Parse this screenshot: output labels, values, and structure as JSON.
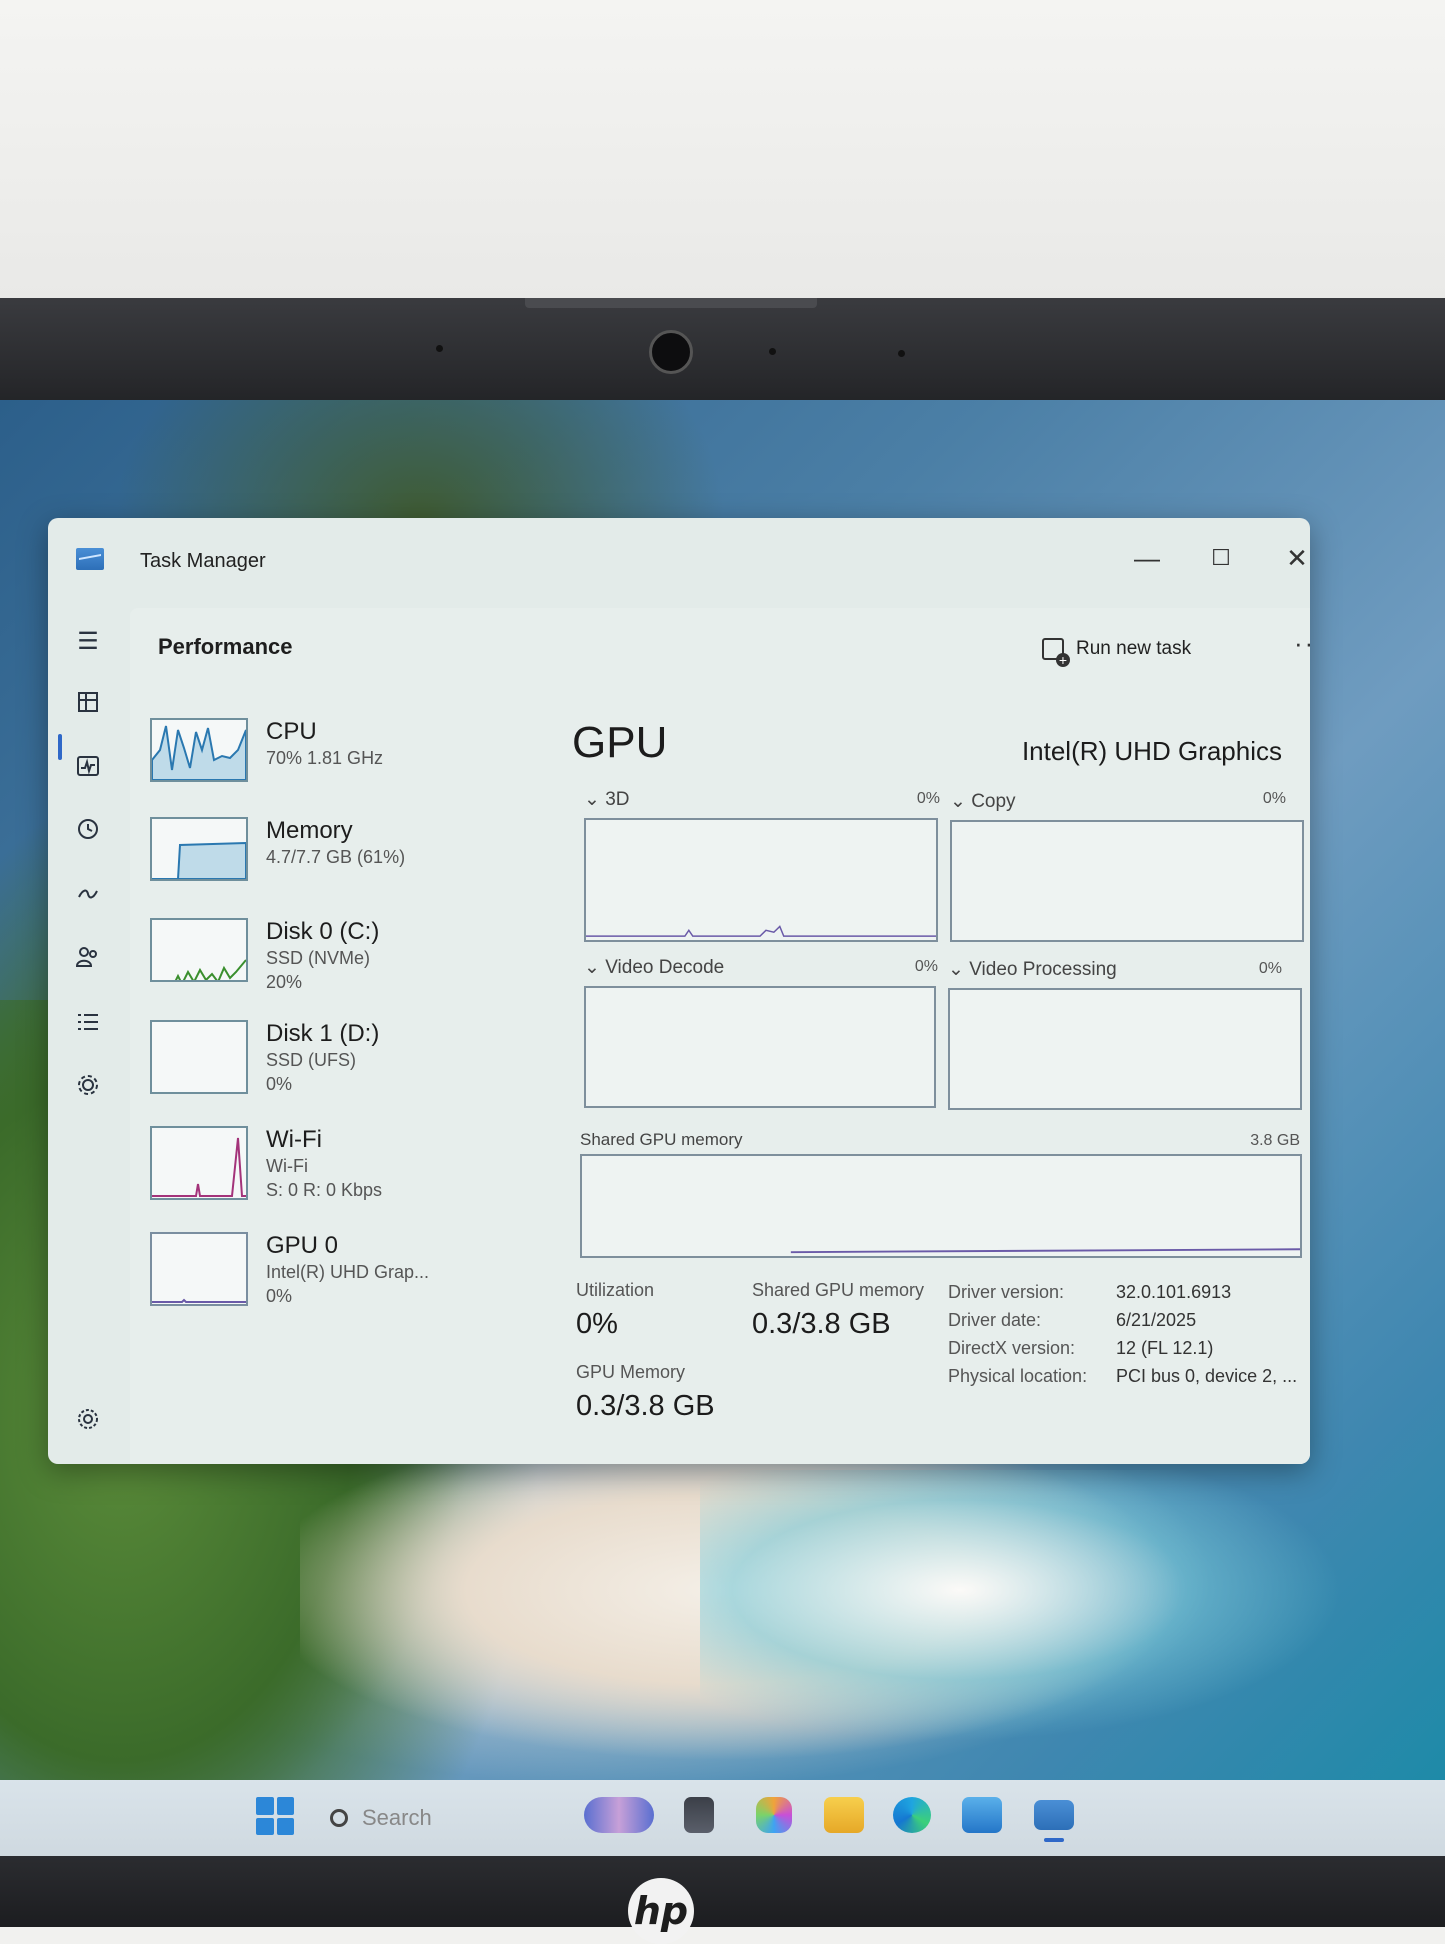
{
  "window": {
    "title": "Task Manager",
    "controls": {
      "minimize": "—",
      "maximize": "☐",
      "close": "✕"
    }
  },
  "header": {
    "section_title": "Performance",
    "run_new_task": "Run new task",
    "more": "···"
  },
  "rail_icons": [
    "hamburger-icon",
    "processes-icon",
    "performance-icon",
    "app-history-icon",
    "startup-apps-icon",
    "users-icon",
    "details-icon",
    "services-icon",
    "settings-icon"
  ],
  "sidebar": {
    "items": [
      {
        "name": "CPU",
        "line1": "70% 1.81 GHz",
        "line2": ""
      },
      {
        "name": "Memory",
        "line1": "4.7/7.7 GB (61%)",
        "line2": ""
      },
      {
        "name": "Disk 0 (C:)",
        "line1": "SSD (NVMe)",
        "line2": "20%"
      },
      {
        "name": "Disk 1 (D:)",
        "line1": "SSD (UFS)",
        "line2": "0%"
      },
      {
        "name": "Wi-Fi",
        "line1": "Wi-Fi",
        "line2": "S: 0 R: 0 Kbps"
      },
      {
        "name": "GPU 0",
        "line1": "Intel(R) UHD Grap...",
        "line2": "0%"
      }
    ]
  },
  "gpu": {
    "title": "GPU",
    "adapter": "Intel(R) UHD Graphics",
    "engines": [
      {
        "label": "3D",
        "pct": "0%"
      },
      {
        "label": "Copy",
        "pct": "0%"
      },
      {
        "label": "Video Decode",
        "pct": "0%"
      },
      {
        "label": "Video Processing",
        "pct": "0%"
      }
    ],
    "shared_memory_chart": {
      "label": "Shared GPU memory",
      "max": "3.8 GB"
    },
    "stats": {
      "utilization_label": "Utilization",
      "utilization_value": "0%",
      "shared_label": "Shared GPU memory",
      "shared_value": "0.3/3.8 GB",
      "gpu_memory_label": "GPU Memory",
      "gpu_memory_value": "0.3/3.8 GB"
    },
    "details": [
      {
        "key": "Driver version:",
        "value": "32.0.101.6913"
      },
      {
        "key": "Driver date:",
        "value": "6/21/2025"
      },
      {
        "key": "DirectX version:",
        "value": "12 (FL 12.1)"
      },
      {
        "key": "Physical location:",
        "value": "PCI bus 0, device 2, ..."
      }
    ]
  },
  "taskbar": {
    "search_placeholder": "Search"
  },
  "colors": {
    "accent": "#2f68c8",
    "cpu_line": "#2a78b0",
    "disk_line": "#3a8f2e",
    "wifi_line": "#a3337a",
    "gpu_line": "#6a5aa8"
  }
}
